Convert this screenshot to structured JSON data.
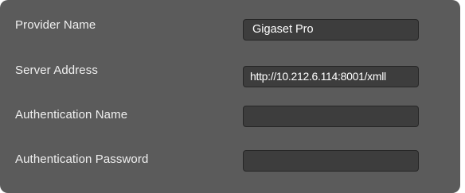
{
  "form": {
    "fields": [
      {
        "label": "Provider Name",
        "value": "Gigaset Pro"
      },
      {
        "label": "Server Address",
        "value": "http://10.212.6.114:8001/xmll"
      },
      {
        "label": "Authentication Name",
        "value": ""
      },
      {
        "label": "Authentication Password",
        "value": ""
      }
    ]
  }
}
